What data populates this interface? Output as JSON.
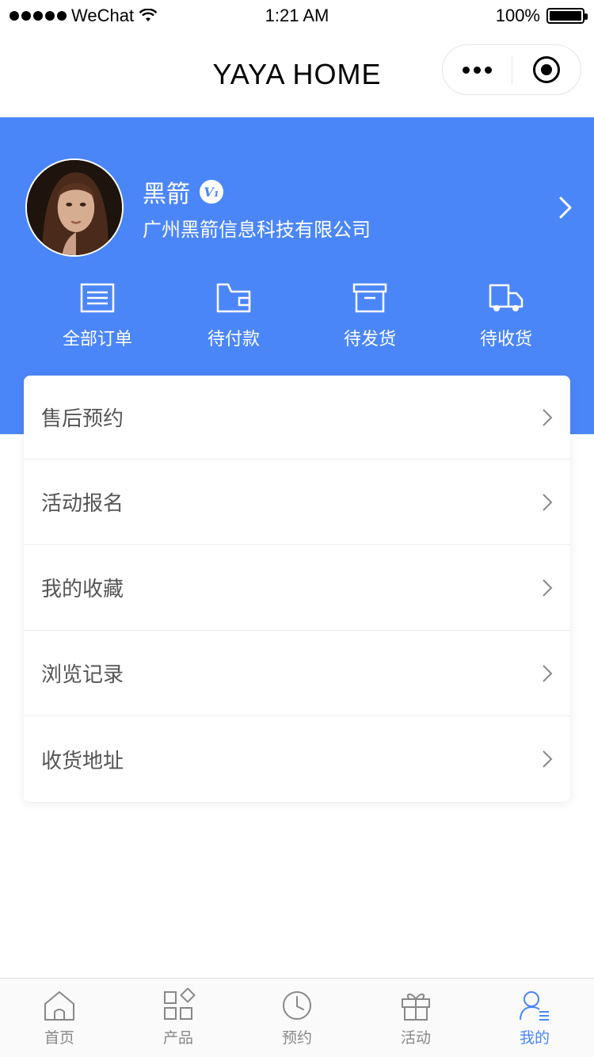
{
  "status_bar": {
    "carrier": "WeChat",
    "time": "1:21 AM",
    "battery": "100%"
  },
  "nav": {
    "title": "YAYA HOME"
  },
  "profile": {
    "name": "黑箭",
    "company": "广州黑箭信息科技有限公司",
    "badge": "V₁"
  },
  "orders": [
    {
      "label": "全部订单",
      "icon": "order-list-icon"
    },
    {
      "label": "待付款",
      "icon": "wallet-icon"
    },
    {
      "label": "待发货",
      "icon": "box-icon"
    },
    {
      "label": "待收货",
      "icon": "truck-icon"
    }
  ],
  "menu": [
    {
      "label": "售后预约"
    },
    {
      "label": "活动报名"
    },
    {
      "label": "我的收藏"
    },
    {
      "label": "浏览记录"
    },
    {
      "label": "收货地址"
    }
  ],
  "tabs": [
    {
      "label": "首页",
      "icon": "home-icon"
    },
    {
      "label": "产品",
      "icon": "grid-icon"
    },
    {
      "label": "预约",
      "icon": "clock-icon"
    },
    {
      "label": "活动",
      "icon": "gift-icon"
    },
    {
      "label": "我的",
      "icon": "user-icon",
      "active": true
    }
  ],
  "colors": {
    "accent": "#4b86f9",
    "tab_inactive": "#888888"
  }
}
